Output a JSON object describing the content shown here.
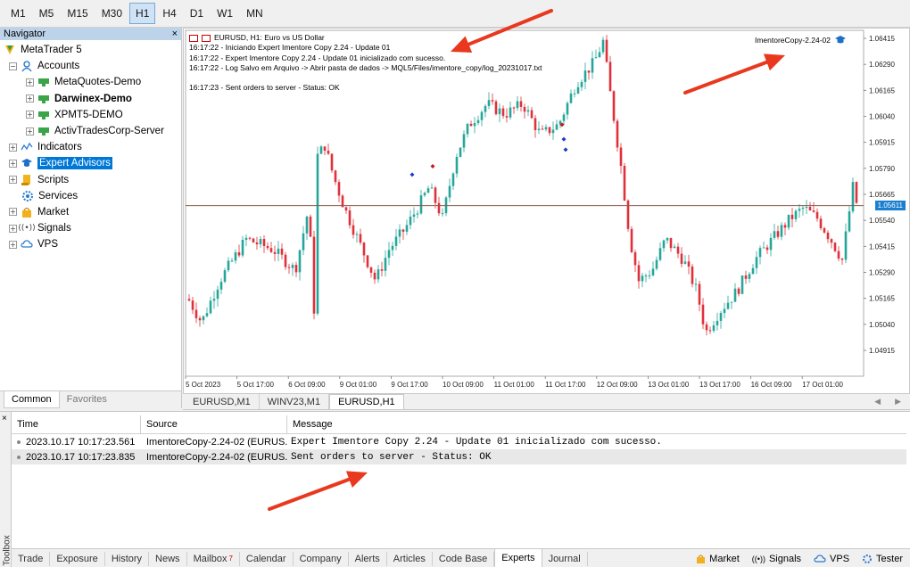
{
  "timeframes": [
    "M1",
    "M5",
    "M15",
    "M30",
    "H1",
    "H4",
    "D1",
    "W1",
    "MN"
  ],
  "active_timeframe": "H1",
  "navigator": {
    "title": "Navigator",
    "close": "×",
    "items": [
      {
        "label": "MetaTrader 5",
        "icon": "metatrader-icon"
      },
      {
        "label": "Accounts",
        "icon": "accounts-icon"
      },
      {
        "label": "MetaQuotes-Demo",
        "icon": "account-server-icon"
      },
      {
        "label": "Darwinex-Demo",
        "icon": "account-server-icon"
      },
      {
        "label": "XPMT5-DEMO",
        "icon": "account-server-icon"
      },
      {
        "label": "ActivTradesCorp-Server",
        "icon": "account-server-icon"
      },
      {
        "label": "Indicators",
        "icon": "indicators-icon"
      },
      {
        "label": "Expert Advisors",
        "icon": "expert-advisors-icon"
      },
      {
        "label": "Scripts",
        "icon": "scripts-icon"
      },
      {
        "label": "Services",
        "icon": "services-icon"
      },
      {
        "label": "Market",
        "icon": "market-icon"
      },
      {
        "label": "Signals",
        "icon": "signals-icon"
      },
      {
        "label": "VPS",
        "icon": "vps-icon"
      }
    ],
    "tabs": [
      "Common",
      "Favorites"
    ]
  },
  "chart": {
    "title": "EURUSD, H1:  Euro vs US Dollar",
    "log": [
      "16:17:22 - Iniciando Expert Imentore Copy 2.24 - Update 01",
      "16:17:22 - Expert Imentore Copy 2.24 - Update 01 inicializado com sucesso.",
      "16:17:22 - Log Salvo em Arquivo -> Abrir pasta de dados -> MQL5/Files/imentore_copy/log_20231017.txt",
      "16:17:23 - Sent orders to server - Status: OK"
    ],
    "ea_name": "ImentoreCopy-2.24-02",
    "current_price": "1.05611",
    "price_labels": [
      "1.06415",
      "1.06290",
      "1.06165",
      "1.06040",
      "1.05915",
      "1.05790",
      "1.05665",
      "1.05540",
      "1.05415",
      "1.05290",
      "1.05165",
      "1.05040",
      "1.04915"
    ],
    "time_labels": [
      "5 Oct 2023",
      "5 Oct 17:00",
      "6 Oct 09:00",
      "9 Oct 01:00",
      "9 Oct 17:00",
      "10 Oct 09:00",
      "11 Oct 01:00",
      "11 Oct 17:00",
      "12 Oct 09:00",
      "13 Oct 01:00",
      "13 Oct 17:00",
      "16 Oct 09:00",
      "17 Oct 01:00"
    ],
    "up_color": "#26a69a",
    "down_color": "#e0313b",
    "price_line_color": "#8b5a4a"
  },
  "chart_tabs": [
    "EURUSD,M1",
    "WINV23,M1",
    "EURUSD,H1"
  ],
  "active_chart_tab": "EURUSD,H1",
  "toolbox": {
    "side_label": "Toolbox",
    "columns": [
      "Time",
      "Source",
      "Message"
    ],
    "rows": [
      {
        "time": "2023.10.17 10:17:23.561",
        "source": "ImentoreCopy-2.24-02 (EURUS...",
        "message": "Expert Imentore Copy 2.24 - Update 01 inicializado com sucesso."
      },
      {
        "time": "2023.10.17 10:17:23.835",
        "source": "ImentoreCopy-2.24-02 (EURUS...",
        "message": "Sent orders to server - Status: OK"
      }
    ],
    "tabs": [
      "Trade",
      "Exposure",
      "History",
      "News",
      "Mailbox",
      "Calendar",
      "Company",
      "Alerts",
      "Articles",
      "Code Base",
      "Experts",
      "Journal"
    ],
    "mailbox_badge": "7",
    "active_tab": "Experts",
    "status_items": [
      "Market",
      "Signals",
      "VPS",
      "Tester"
    ]
  },
  "annotation_color": "#e8391e"
}
